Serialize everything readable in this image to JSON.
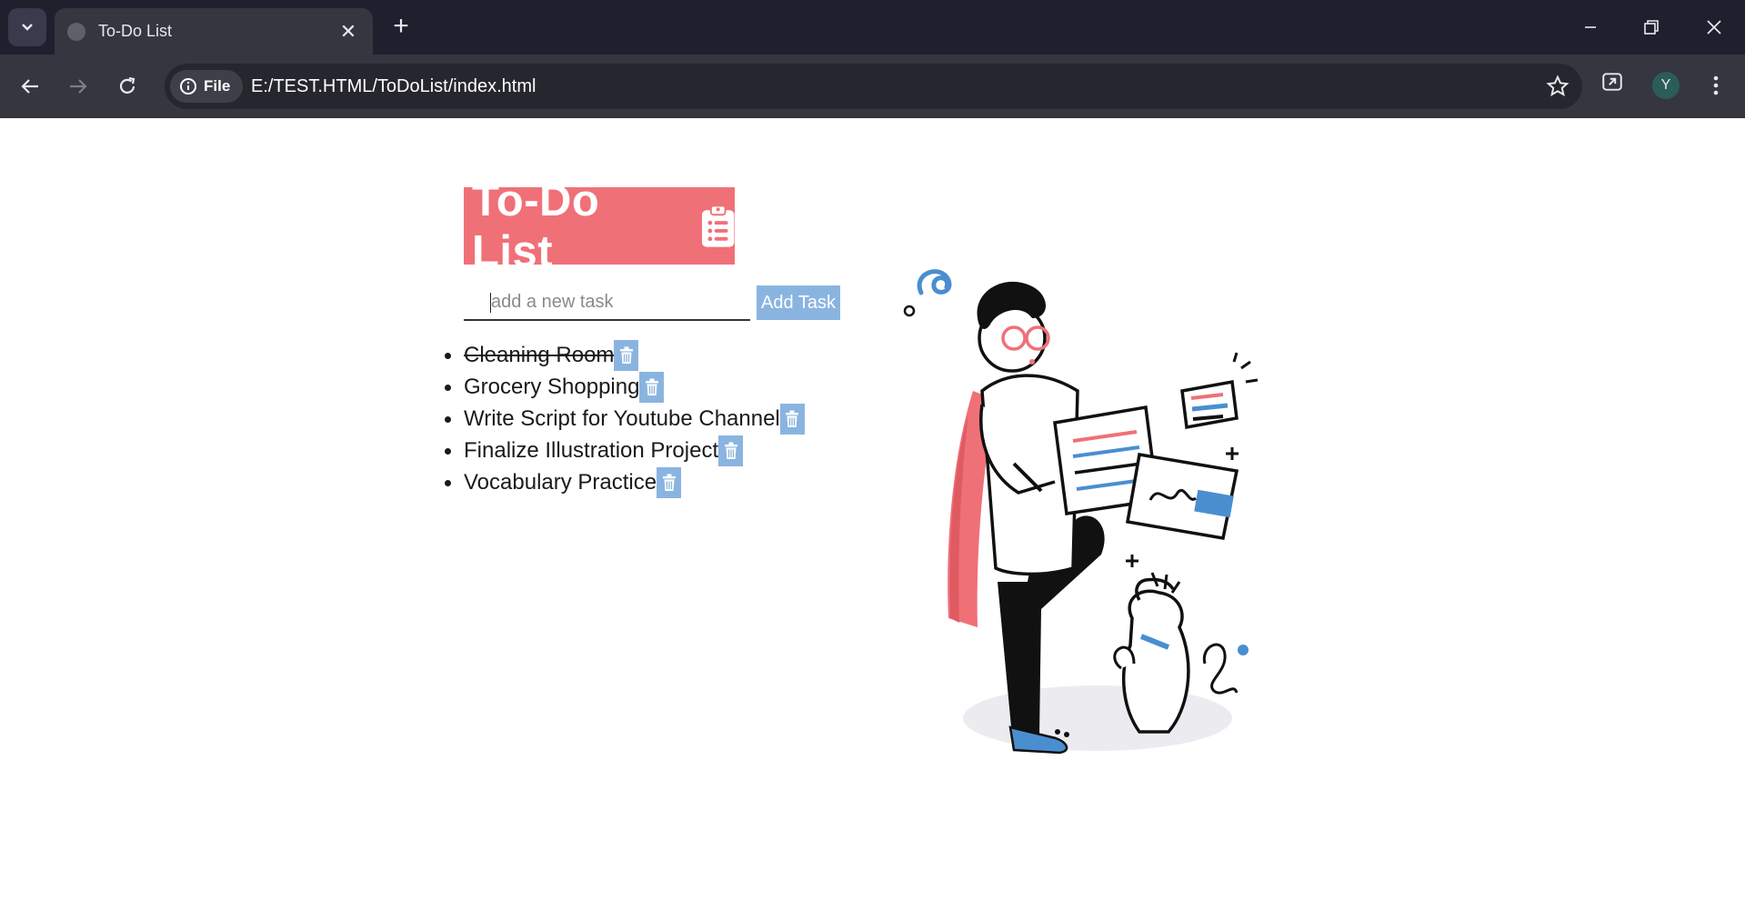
{
  "browser": {
    "tab_title": "To-Do List",
    "chip_label": "File",
    "url": "E:/TEST.HTML/ToDoList/index.html",
    "avatar_initial": "Y"
  },
  "app": {
    "heading": "To-Do List",
    "input_placeholder": "add a new task",
    "add_button_label": "Add Task",
    "tasks": [
      {
        "text": "Cleaning Room",
        "completed": true
      },
      {
        "text": "Grocery Shopping",
        "completed": false
      },
      {
        "text": "Write Script for Youtube Channel",
        "completed": false
      },
      {
        "text": "Finalize Illustration Project",
        "completed": false
      },
      {
        "text": "Vocabulary Practice",
        "completed": false
      }
    ]
  },
  "colors": {
    "heading_bg": "#f07078",
    "button_bg": "#8ab4e0",
    "illustration_accent_red": "#f07078",
    "illustration_accent_blue": "#4a8ed0"
  }
}
